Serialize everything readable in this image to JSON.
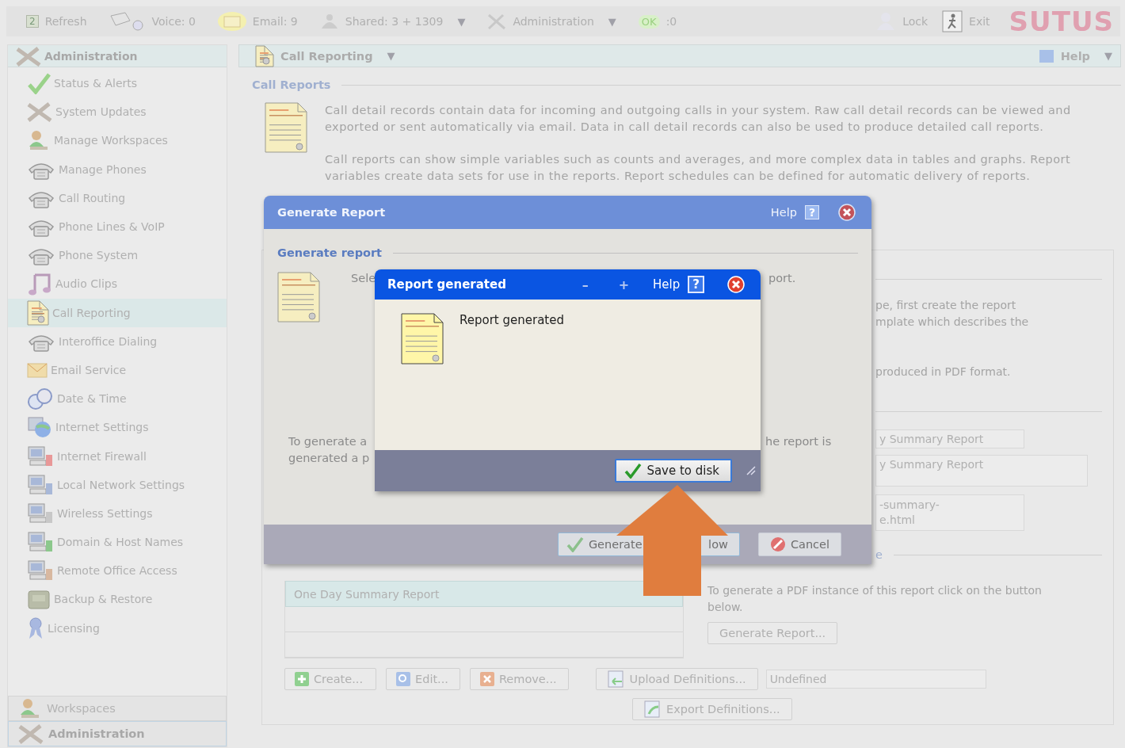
{
  "toolbar": {
    "items": [
      {
        "icon_text": "2",
        "label": "Refresh"
      },
      {
        "label": "Voice: 0"
      },
      {
        "label": "Email: 9"
      },
      {
        "label": "Shared: 3 + 1309",
        "caret": "▼"
      },
      {
        "label": "Administration",
        "caret": "▼"
      },
      {
        "icon_text": "OK",
        "label": ":0"
      }
    ],
    "right_items": [
      {
        "label": "Lock"
      },
      {
        "label": "Exit"
      }
    ],
    "logo": "SUTUS"
  },
  "sidebar": {
    "title": "Administration",
    "items": [
      {
        "label": "Status & Alerts",
        "selected": false
      },
      {
        "label": "System Updates",
        "selected": false
      },
      {
        "label": "Manage Workspaces",
        "selected": false
      },
      {
        "label": "Manage Phones",
        "selected": false
      },
      {
        "label": "Call Routing",
        "selected": false
      },
      {
        "label": "Phone Lines & VoIP",
        "selected": false
      },
      {
        "label": "Phone System",
        "selected": false
      },
      {
        "label": "Audio Clips",
        "selected": false
      },
      {
        "label": "Call Reporting",
        "selected": true
      },
      {
        "label": "Interoffice Dialing",
        "selected": false
      },
      {
        "label": "Email Service",
        "selected": false
      },
      {
        "label": "Date & Time",
        "selected": false
      },
      {
        "label": "Internet Settings",
        "selected": false
      },
      {
        "label": "Internet Firewall",
        "selected": false
      },
      {
        "label": "Local Network Settings",
        "selected": false
      },
      {
        "label": "Wireless Settings",
        "selected": false
      },
      {
        "label": "Domain & Host Names",
        "selected": false
      },
      {
        "label": "Remote Office Access",
        "selected": false
      },
      {
        "label": "Backup & Restore",
        "selected": false
      },
      {
        "label": "Licensing",
        "selected": false
      }
    ],
    "bottom_tabs": [
      {
        "label": "Workspaces",
        "selected": false
      },
      {
        "label": "Administration",
        "selected": true
      }
    ]
  },
  "main": {
    "title": "Call Reporting",
    "title_caret": "▼",
    "help": "Help",
    "help_caret": "▼",
    "section_title": "Call Reports",
    "paragraphs": [
      "Call detail records contain data for incoming and outgoing calls in your system.  Raw call detail records can be viewed and exported or sent automatically via email.  Data in call detail records can also be used to produce detailed call reports.",
      "Call reports can show simple variables such as counts and averages, and more complex data in tables and graphs.  Report variables create data sets for use in the reports.  Report schedules can be defined for automatic delivery of reports."
    ],
    "panel": {
      "fragments": [
        "pe, first create the report",
        "mplate which describes the",
        "produced in PDF format."
      ],
      "name_field": "y Summary Report",
      "description_field": "y Summary Report",
      "file_field": [
        "-summary-",
        "e.html"
      ],
      "section_fragment": "e",
      "reports": [
        {
          "name": "One Day Summary Report",
          "selected": true
        },
        {
          "selected": false
        },
        {
          "selected": false
        }
      ],
      "generate_text": "To generate a PDF instance of this report click on the button below.",
      "generate_button": "Generate Report...",
      "buttons": [
        "Create...",
        "Edit...",
        "Remove..."
      ],
      "upload_button": "Upload Definitions...",
      "upload_field": "Undefined",
      "export_button": "Export Definitions..."
    }
  },
  "generate_dialog": {
    "title": "Generate Report",
    "help": "Help",
    "help_icon": "?",
    "section_title": "Generate report",
    "line_start": "Sele",
    "line_end": "port.",
    "para_start": [
      "To generate a",
      "generated a p"
    ],
    "para_end": "he report is",
    "generate_button": [
      "Generate",
      "low"
    ],
    "cancel_button": "Cancel"
  },
  "result_dialog": {
    "title": "Report generated",
    "minimize": "–",
    "maximize": "+",
    "help": "Help",
    "help_icon": "?",
    "message": "Report generated",
    "save_button": "Save to disk"
  }
}
